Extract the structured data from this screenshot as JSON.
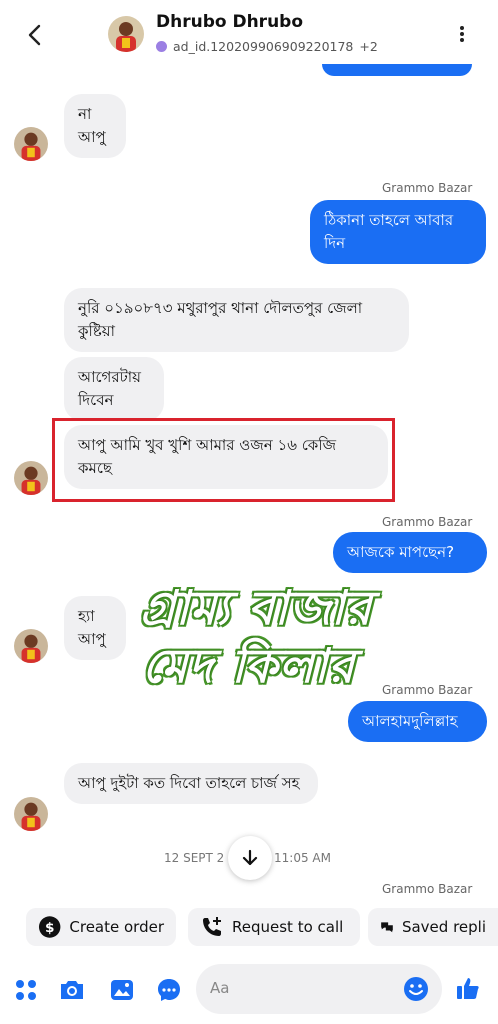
{
  "header": {
    "name": "Dhrubo Dhrubo",
    "subtitle": "ad_id.120209906909220178",
    "extra_count": "+2"
  },
  "messages": {
    "m1": "না\nআপু",
    "sender1": "Grammo Bazar",
    "m2": "ঠিকানা তাহলে আবার দিন",
    "m3": "নুরি ০১৯০৮৭৩          মথুরাপুর থানা দৌলতপুর জেলা কুষ্টিয়া",
    "m4": "আগেরটায় দিবেন",
    "m5": "আপু আমি খুব খুশি আমার ওজন ১৬ কেজি কমছে",
    "sender2": "Grammo Bazar",
    "m6": "আজকে মাপছেন?",
    "m7": "হ্যা\nআপু",
    "sender3": "Grammo Bazar",
    "m8": "আলহামদুলিল্লাহ",
    "m9": "আপু দুইটা কত দিবো তাহলে চার্জ সহ",
    "sender4": "Grammo Bazar"
  },
  "watermark": {
    "line1": "গ্রাম্য বাজার",
    "line2": "মেদ কিলার"
  },
  "timestamp": {
    "left": "12 SEPT 2",
    "right": "11:05 AM"
  },
  "quick_actions": {
    "create_order": "Create order",
    "request_call": "Request to call",
    "saved_replies": "Saved repli"
  },
  "composer": {
    "placeholder": "Aa"
  },
  "colors": {
    "accent": "#1a6ef3",
    "incoming_bubble": "#f0f0f2",
    "highlight_box": "#d9232d"
  }
}
